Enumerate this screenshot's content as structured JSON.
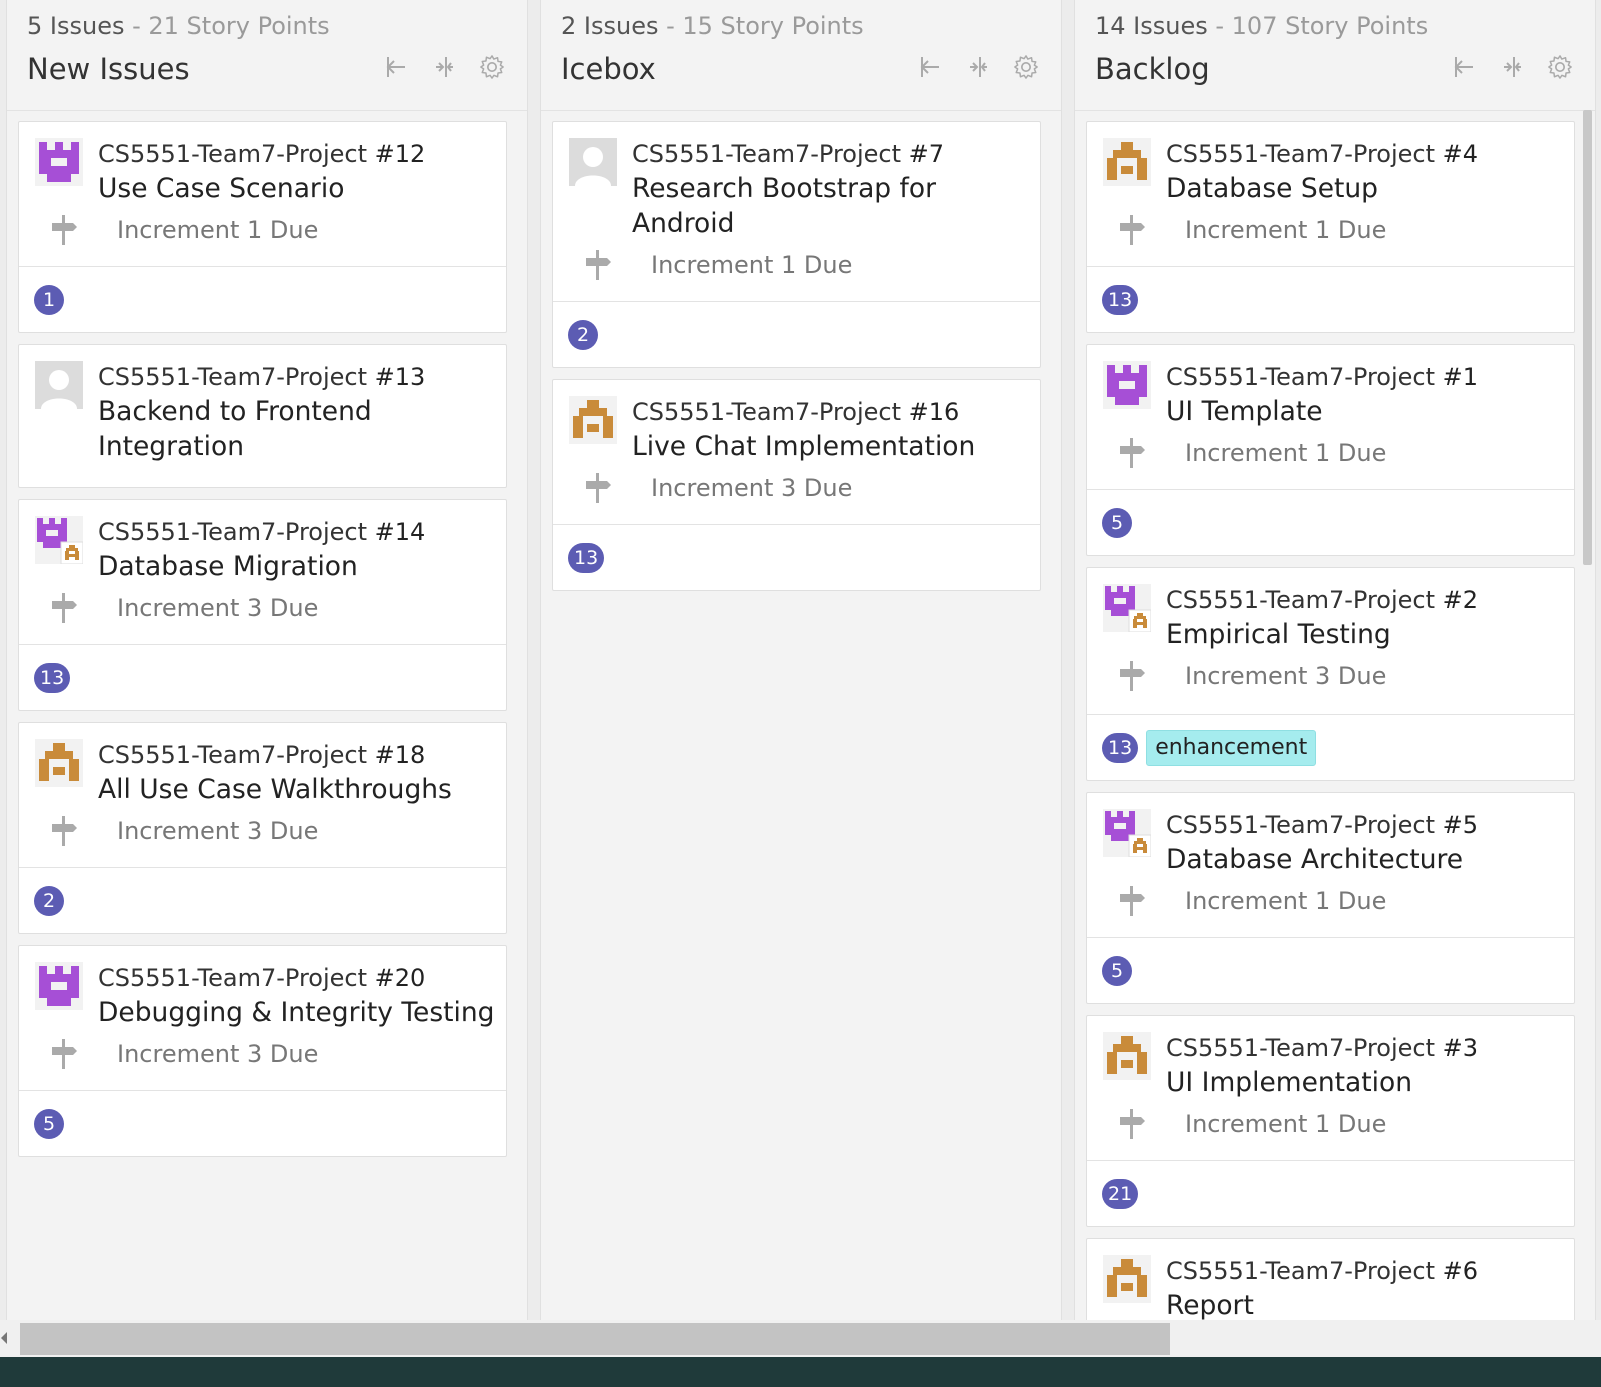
{
  "colors": {
    "estimate": "#5c5cb3",
    "enhancement_label": "#a5ecee",
    "avatar_purple": "#a64fd6",
    "avatar_gold": "#c98b3a"
  },
  "icons": {
    "collapse": "collapse-left-icon",
    "minimize": "minimize-icon",
    "settings": "gear-icon",
    "milestone": "milestone-signpost-icon"
  },
  "pipelines": [
    {
      "issues": "5 Issues",
      "points": "21 Story Points",
      "name": "New Issues",
      "cards": [
        {
          "repo": "CS5551-Team7-Project",
          "number": "#12",
          "title": "Use Case Scenario",
          "milestone": "Increment 1 Due",
          "estimate": "1",
          "avatar": "purple"
        },
        {
          "repo": "CS5551-Team7-Project",
          "number": "#13",
          "title": "Backend to Frontend Integration",
          "milestone": "",
          "estimate": "",
          "avatar": "default"
        },
        {
          "repo": "CS5551-Team7-Project",
          "number": "#14",
          "title": "Database Migration",
          "milestone": "Increment 3 Due",
          "estimate": "13",
          "avatar": "multi"
        },
        {
          "repo": "CS5551-Team7-Project",
          "number": "#18",
          "title": "All Use Case Walkthroughs",
          "milestone": "Increment 3 Due",
          "estimate": "2",
          "avatar": "gold"
        },
        {
          "repo": "CS5551-Team7-Project",
          "number": "#20",
          "title": "Debugging & Integrity Testing",
          "milestone": "Increment 3 Due",
          "estimate": "5",
          "avatar": "purple"
        }
      ]
    },
    {
      "issues": "2 Issues",
      "points": "15 Story Points",
      "name": "Icebox",
      "cards": [
        {
          "repo": "CS5551-Team7-Project",
          "number": "#7",
          "title": "Research Bootstrap for Android",
          "milestone": "Increment 1 Due",
          "estimate": "2",
          "avatar": "default"
        },
        {
          "repo": "CS5551-Team7-Project",
          "number": "#16",
          "title": "Live Chat Implementation",
          "milestone": "Increment 3 Due",
          "estimate": "13",
          "avatar": "gold"
        }
      ]
    },
    {
      "issues": "14 Issues",
      "points": "107 Story Points",
      "name": "Backlog",
      "cards": [
        {
          "repo": "CS5551-Team7-Project",
          "number": "#4",
          "title": "Database Setup",
          "milestone": "Increment 1 Due",
          "estimate": "13",
          "avatar": "gold"
        },
        {
          "repo": "CS5551-Team7-Project",
          "number": "#1",
          "title": "UI Template",
          "milestone": "Increment 1 Due",
          "estimate": "5",
          "avatar": "purple"
        },
        {
          "repo": "CS5551-Team7-Project",
          "number": "#2",
          "title": "Empirical Testing",
          "milestone": "Increment 3 Due",
          "estimate": "13",
          "label": "enhancement",
          "avatar": "multi"
        },
        {
          "repo": "CS5551-Team7-Project",
          "number": "#5",
          "title": "Database Architecture",
          "milestone": "Increment 1 Due",
          "estimate": "5",
          "avatar": "multi"
        },
        {
          "repo": "CS5551-Team7-Project",
          "number": "#3",
          "title": "UI Implementation",
          "milestone": "Increment 1 Due",
          "estimate": "21",
          "avatar": "gold"
        },
        {
          "repo": "CS5551-Team7-Project",
          "number": "#6",
          "title": "Report",
          "milestone": "",
          "estimate": "",
          "avatar": "gold"
        }
      ]
    }
  ]
}
